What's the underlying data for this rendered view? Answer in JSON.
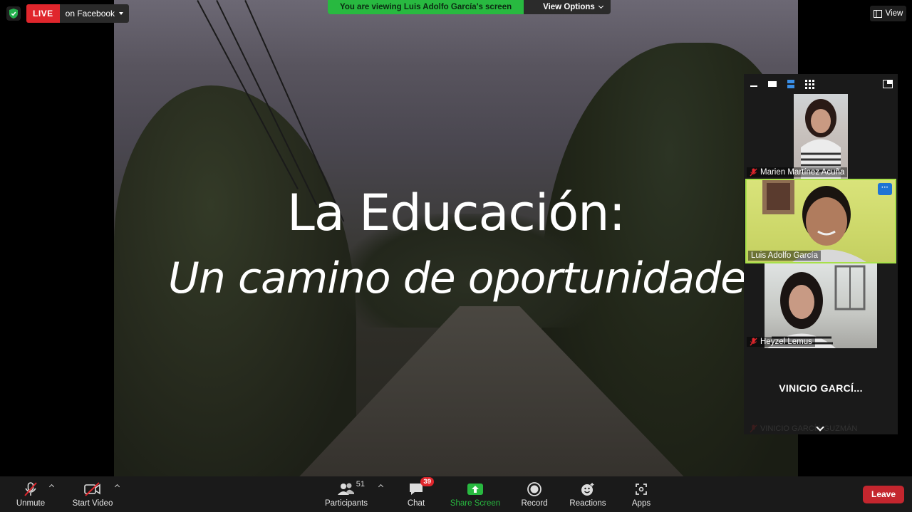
{
  "top_bar": {
    "live_badge": "LIVE",
    "live_destination": "on Facebook",
    "viewing_banner": "You are viewing Luis Adolfo García's screen",
    "view_options_label": "View Options",
    "view_label": "View"
  },
  "slide": {
    "title": "La Educación:",
    "subtitle": "Un camino de oportunidades"
  },
  "participants_panel": {
    "tiles": [
      {
        "name": "Marien Martínez Acuña",
        "muted": true
      },
      {
        "name": "Luis Adolfo García",
        "muted": false,
        "active_speaker": true,
        "more_label": "···"
      },
      {
        "name": "Heyzel Lemus",
        "muted": true
      },
      {
        "display_name": "VINICIO GARCÍ...",
        "name": "VINICIO GARCÍA GUZMÁN",
        "muted": true
      }
    ]
  },
  "toolbar": {
    "unmute_label": "Unmute",
    "start_video_label": "Start Video",
    "participants_label": "Participants",
    "participants_count": "51",
    "chat_label": "Chat",
    "chat_unread": "39",
    "share_screen_label": "Share Screen",
    "record_label": "Record",
    "reactions_label": "Reactions",
    "apps_label": "Apps",
    "leave_label": "Leave"
  },
  "colors": {
    "live_red": "#e0262c",
    "banner_green": "#28b940",
    "active_border": "#a8e04a",
    "leave_red": "#c4262e"
  }
}
